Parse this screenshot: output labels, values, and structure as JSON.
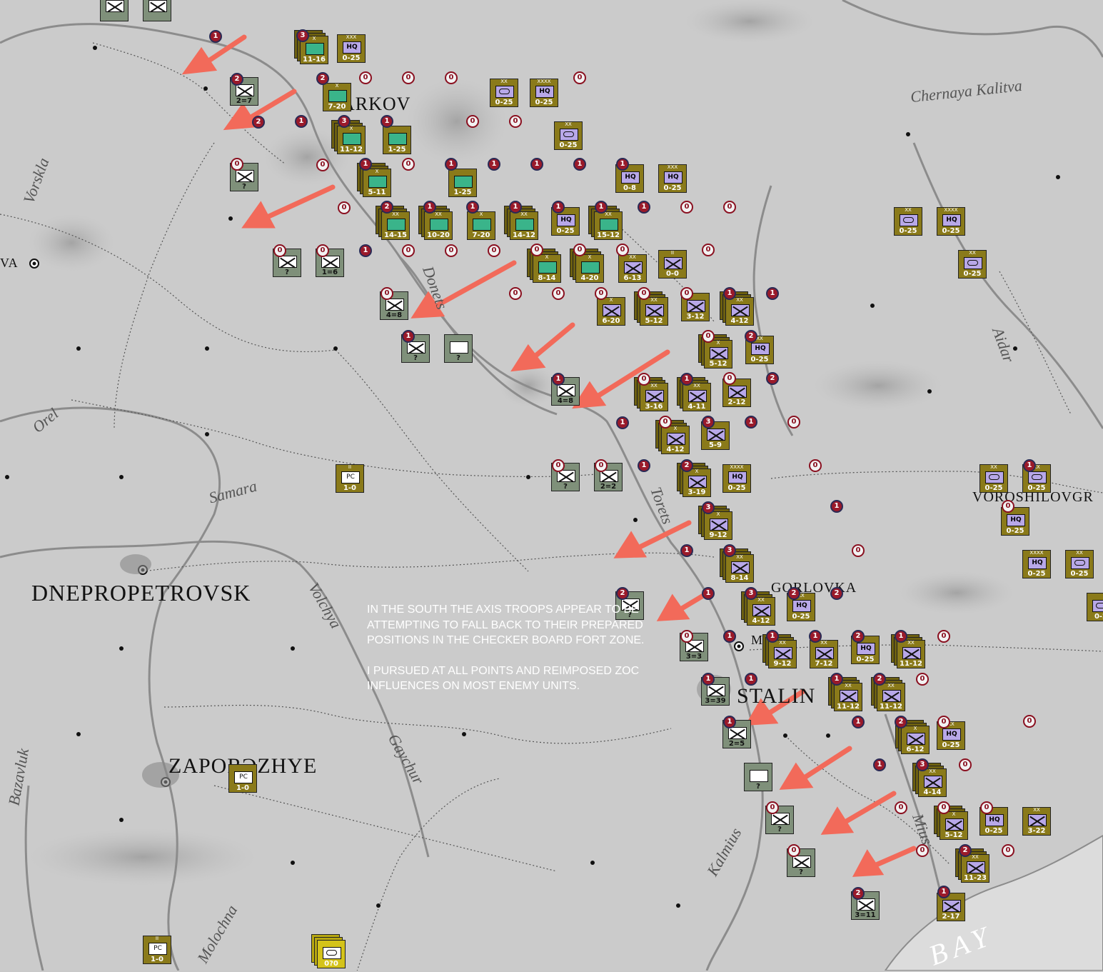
{
  "map": {
    "cities": [
      {
        "id": "kharkov",
        "label": "ARKOV"
      },
      {
        "id": "dnepropetrovsk",
        "label": "DNEPROPETROVSK"
      },
      {
        "id": "zaporozhye",
        "label": "ZAPORƆZHYE"
      },
      {
        "id": "stalino",
        "label": "STALIN"
      },
      {
        "id": "gorlovka",
        "label": "GORLOVKA"
      },
      {
        "id": "voroshilovgrad",
        "label": "VOROSHILOVGR"
      },
      {
        "id": "poltava",
        "label": "VA"
      },
      {
        "id": "makeevka",
        "label": "M"
      }
    ],
    "rivers": [
      {
        "id": "vorskla",
        "label": "Vorskla"
      },
      {
        "id": "chernaya-kalitva",
        "label": "Chernaya Kalitva"
      },
      {
        "id": "orel",
        "label": "Orel"
      },
      {
        "id": "samara",
        "label": "Samara"
      },
      {
        "id": "volchya",
        "label": "Volchya"
      },
      {
        "id": "gaychur",
        "label": "Gaychur"
      },
      {
        "id": "bazavluk",
        "label": "Bazavluk"
      },
      {
        "id": "molochna",
        "label": "Molochna"
      },
      {
        "id": "kalmius",
        "label": "Kalmius"
      },
      {
        "id": "aidar",
        "label": "Aidar"
      },
      {
        "id": "donets",
        "label": "Donets"
      },
      {
        "id": "torets",
        "label": "Torets"
      },
      {
        "id": "mius",
        "label": "Mius"
      },
      {
        "id": "bay",
        "label": "BAY"
      }
    ]
  },
  "note": {
    "paragraph1": "In the south the Axis troops appear to be attempting to fall back to their prepared positions in the checker board fort zone.",
    "paragraph2": "I pursued at all points and reimposed ZOC influences on most enemy units."
  },
  "colors": {
    "axis": "#8a7a1a",
    "soviet": "#7f907a",
    "arrow": "#f26a5a",
    "marker": "#9a1a2a"
  },
  "counters": [
    {
      "side": "axis",
      "type": "arm",
      "size": "X",
      "value": "11-16"
    },
    {
      "side": "axis",
      "type": "hq",
      "size": "XXX",
      "value": "0-25"
    },
    {
      "side": "axis",
      "type": "arm",
      "size": "X",
      "value": "7-20"
    },
    {
      "side": "axis",
      "type": "arm",
      "size": "X",
      "value": "11-12"
    },
    {
      "side": "axis",
      "type": "arm",
      "size": "",
      "value": "1-25"
    },
    {
      "side": "axis",
      "type": "arm",
      "size": "X",
      "value": "5-11"
    },
    {
      "side": "axis",
      "type": "arm",
      "size": "",
      "value": "1-25"
    },
    {
      "side": "axis",
      "type": "recon",
      "size": "XX",
      "value": "0-25"
    },
    {
      "side": "axis",
      "type": "hq",
      "size": "XXXX",
      "value": "0-25"
    },
    {
      "side": "axis",
      "type": "recon",
      "size": "XX",
      "value": "0-25"
    },
    {
      "side": "axis",
      "type": "hq",
      "size": "",
      "value": "0-8"
    },
    {
      "side": "axis",
      "type": "hq",
      "size": "XXX",
      "value": "0-25"
    },
    {
      "side": "axis",
      "type": "arm",
      "size": "XX",
      "value": "14-15"
    },
    {
      "side": "axis",
      "type": "arm",
      "size": "XX",
      "value": "10-20"
    },
    {
      "side": "axis",
      "type": "arm",
      "size": "X",
      "value": "7-20"
    },
    {
      "side": "axis",
      "type": "arm",
      "size": "XX",
      "value": "14-12"
    },
    {
      "side": "axis",
      "type": "hq",
      "size": "",
      "value": "0-25"
    },
    {
      "side": "axis",
      "type": "arm",
      "size": "XX",
      "value": "15-12"
    },
    {
      "side": "axis",
      "type": "arm",
      "size": "X",
      "value": "8-14"
    },
    {
      "side": "axis",
      "type": "arm",
      "size": "X",
      "value": "4-20"
    },
    {
      "side": "axis",
      "type": "inf",
      "size": "XX",
      "value": "6-13"
    },
    {
      "side": "axis",
      "type": "inf",
      "size": "II",
      "value": "0-0"
    },
    {
      "side": "axis",
      "type": "recon",
      "size": "XX",
      "value": "0-25"
    },
    {
      "side": "axis",
      "type": "hq",
      "size": "XXXX",
      "value": "0-25"
    },
    {
      "side": "axis",
      "type": "recon",
      "size": "XX",
      "value": "0-25"
    },
    {
      "side": "axis",
      "type": "inf",
      "size": "X",
      "value": "6-20"
    },
    {
      "side": "axis",
      "type": "inf",
      "size": "XX",
      "value": "5-12"
    },
    {
      "side": "axis",
      "type": "inf",
      "size": "",
      "value": "3-12"
    },
    {
      "side": "axis",
      "type": "inf",
      "size": "XX",
      "value": "4-12"
    },
    {
      "side": "axis",
      "type": "inf",
      "size": "X",
      "value": "5-12"
    },
    {
      "side": "axis",
      "type": "hq",
      "size": "XX",
      "value": "0-25"
    },
    {
      "side": "axis",
      "type": "inf",
      "size": "XX",
      "value": "3-16"
    },
    {
      "side": "axis",
      "type": "inf",
      "size": "XX",
      "value": "4-11"
    },
    {
      "side": "axis",
      "type": "inf",
      "size": "",
      "value": "2-12"
    },
    {
      "side": "axis",
      "type": "inf",
      "size": "X",
      "value": "4-12"
    },
    {
      "side": "axis",
      "type": "inf",
      "size": "",
      "value": "5-9"
    },
    {
      "side": "axis",
      "type": "inf",
      "size": "X",
      "value": "3-19"
    },
    {
      "side": "axis",
      "type": "hq",
      "size": "XXXX",
      "value": "0-25"
    },
    {
      "side": "axis",
      "type": "inf",
      "size": "X",
      "value": "9-12"
    },
    {
      "side": "axis",
      "type": "inf",
      "size": "XX",
      "value": "8-14"
    },
    {
      "side": "axis",
      "type": "inf",
      "size": "XX",
      "value": "4-12"
    },
    {
      "side": "axis",
      "type": "hq",
      "size": "XX",
      "value": "0-25"
    },
    {
      "side": "axis",
      "type": "inf",
      "size": "XX",
      "value": "9-12"
    },
    {
      "side": "axis",
      "type": "inf",
      "size": "XX",
      "value": "7-12"
    },
    {
      "side": "axis",
      "type": "hq",
      "size": "",
      "value": "0-25"
    },
    {
      "side": "axis",
      "type": "inf",
      "size": "XX",
      "value": "11-12"
    },
    {
      "side": "axis",
      "type": "inf",
      "size": "XX",
      "value": "11-12"
    },
    {
      "side": "axis",
      "type": "inf",
      "size": "XX",
      "value": "11-12"
    },
    {
      "side": "axis",
      "type": "inf",
      "size": "X",
      "value": "6-12"
    },
    {
      "side": "axis",
      "type": "hq",
      "size": "XX",
      "value": "0-25"
    },
    {
      "side": "axis",
      "type": "inf",
      "size": "XX",
      "value": "4-14"
    },
    {
      "side": "axis",
      "type": "inf",
      "size": "X",
      "value": "5-12"
    },
    {
      "side": "axis",
      "type": "hq",
      "size": "",
      "value": "0-25"
    },
    {
      "side": "axis",
      "type": "inf",
      "size": "XX",
      "value": "3-22"
    },
    {
      "side": "axis",
      "type": "inf",
      "size": "XX",
      "value": "11-23"
    },
    {
      "side": "axis",
      "type": "inf",
      "size": "",
      "value": "2-17"
    },
    {
      "side": "axis",
      "type": "recon",
      "size": "XX",
      "value": "0-25"
    },
    {
      "side": "axis",
      "type": "recon",
      "size": "XX",
      "value": "0-25"
    },
    {
      "side": "axis",
      "type": "hq",
      "size": "",
      "value": "0-25"
    },
    {
      "side": "axis",
      "type": "hq",
      "size": "XXXX",
      "value": "0-25"
    },
    {
      "side": "axis",
      "type": "recon",
      "size": "XX",
      "value": "0-25"
    },
    {
      "side": "axis",
      "type": "recon",
      "size": "",
      "value": "0-2"
    },
    {
      "side": "axis",
      "type": "pc",
      "size": "II",
      "value": "1-0"
    },
    {
      "side": "axis",
      "type": "pc",
      "size": "",
      "value": "1-0"
    },
    {
      "side": "axis",
      "type": "pc",
      "size": "II",
      "value": "1-0"
    },
    {
      "side": "yellow",
      "type": "recon",
      "size": "",
      "value": "0?0"
    },
    {
      "side": "sov",
      "type": "inf",
      "size": "",
      "value": ""
    },
    {
      "side": "sov",
      "type": "inf",
      "size": "",
      "value": ""
    },
    {
      "side": "sov",
      "type": "inf",
      "size": "",
      "value": "2=7"
    },
    {
      "side": "sov",
      "type": "inf",
      "size": "",
      "value": "?"
    },
    {
      "side": "sov",
      "type": "inf",
      "size": "",
      "value": "?"
    },
    {
      "side": "sov",
      "type": "inf",
      "size": "",
      "value": "1=6"
    },
    {
      "side": "sov",
      "type": "inf",
      "size": "",
      "value": "4=8"
    },
    {
      "side": "sov",
      "type": "inf",
      "size": "",
      "value": "?"
    },
    {
      "side": "sov",
      "type": "blank",
      "size": "",
      "value": "?"
    },
    {
      "side": "sov",
      "type": "inf",
      "size": "",
      "value": "4=8"
    },
    {
      "side": "sov",
      "type": "inf",
      "size": "",
      "value": "?"
    },
    {
      "side": "sov",
      "type": "inf",
      "size": "",
      "value": "2=2"
    },
    {
      "side": "sov",
      "type": "inf",
      "size": "",
      "value": "?"
    },
    {
      "side": "sov",
      "type": "inf",
      "size": "",
      "value": "3=3"
    },
    {
      "side": "sov",
      "type": "inf",
      "size": "",
      "value": "3=39"
    },
    {
      "side": "sov",
      "type": "inf",
      "size": "",
      "value": "2=5"
    },
    {
      "side": "sov",
      "type": "blank",
      "size": "",
      "value": "?"
    },
    {
      "side": "sov",
      "type": "inf",
      "size": "",
      "value": "?"
    },
    {
      "side": "sov",
      "type": "inf",
      "size": "",
      "value": "?"
    },
    {
      "side": "sov",
      "type": "inf",
      "size": "",
      "value": "3=11"
    }
  ],
  "markers": [
    "0",
    "1",
    "2",
    "3"
  ]
}
